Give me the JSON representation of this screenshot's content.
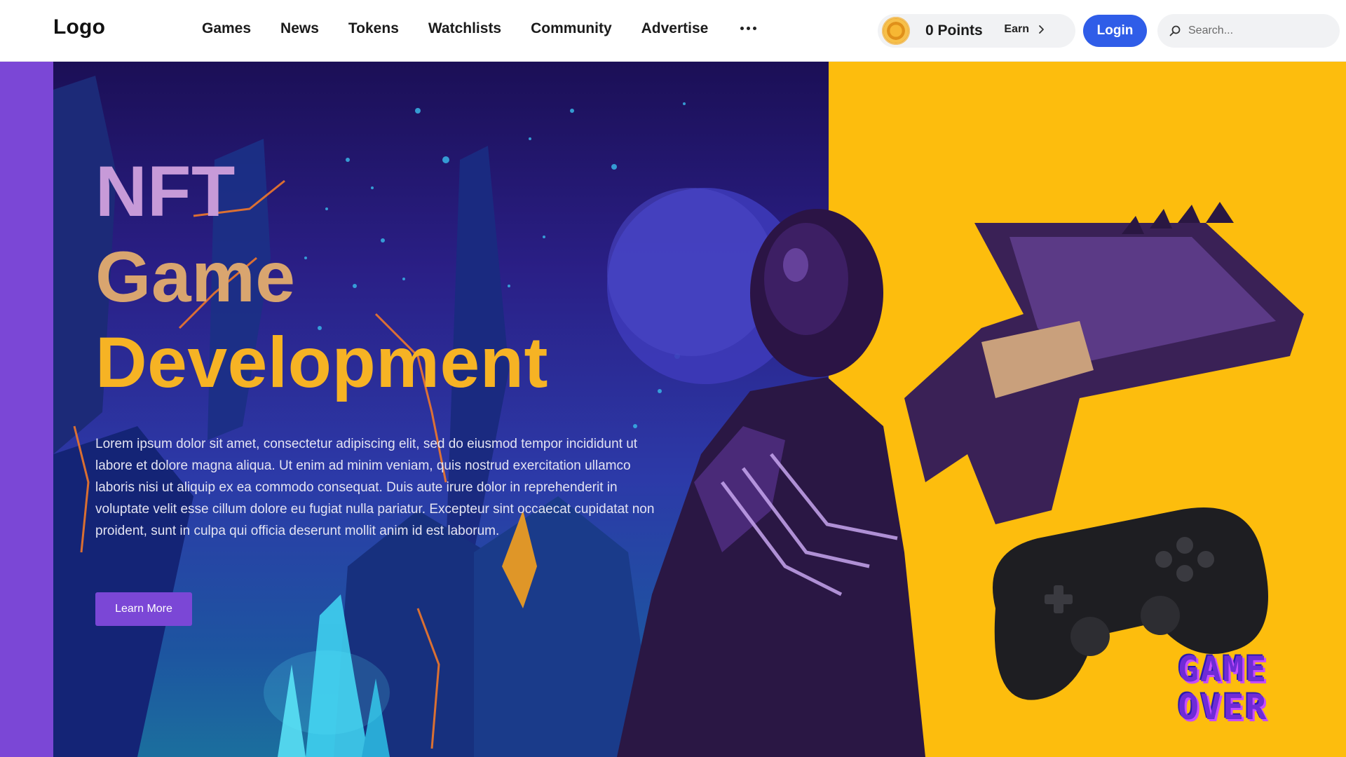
{
  "header": {
    "logo": "Logo",
    "nav": [
      "Games",
      "News",
      "Tokens",
      "Watchlists",
      "Community",
      "Advertise"
    ],
    "points": "0 Points",
    "earn_label": "Earn",
    "login_label": "Login",
    "search_placeholder": "Search..."
  },
  "hero": {
    "title_line1": "NFT",
    "title_line2": "Game",
    "title_line3": "Development",
    "description": "Lorem ipsum dolor sit amet, consectetur adipiscing elit, sed do eiusmod tempor incididunt ut labore et dolore magna aliqua. Ut enim ad minim veniam, quis nostrud exercitation ullamco laboris nisi ut aliquip ex ea commodo consequat. Duis aute irure dolor in reprehenderit in voluptate velit esse cillum dolore eu fugiat nulla pariatur. Excepteur sint occaecat cupidatat non proident, sunt in culpa qui officia deserunt mollit anim id est laborum.",
    "cta_label": "Learn More",
    "badge_line1": "GAME",
    "badge_line2": "OVER"
  },
  "colors": {
    "accent_purple": "#7b47d6",
    "login_blue": "#2f5de8",
    "panel_yellow": "#fdbd0d",
    "title_orange": "#f6b324"
  },
  "icons": [
    "more-icon",
    "coin-icon",
    "chevron-right-icon",
    "search-icon",
    "gamepad-icon"
  ]
}
